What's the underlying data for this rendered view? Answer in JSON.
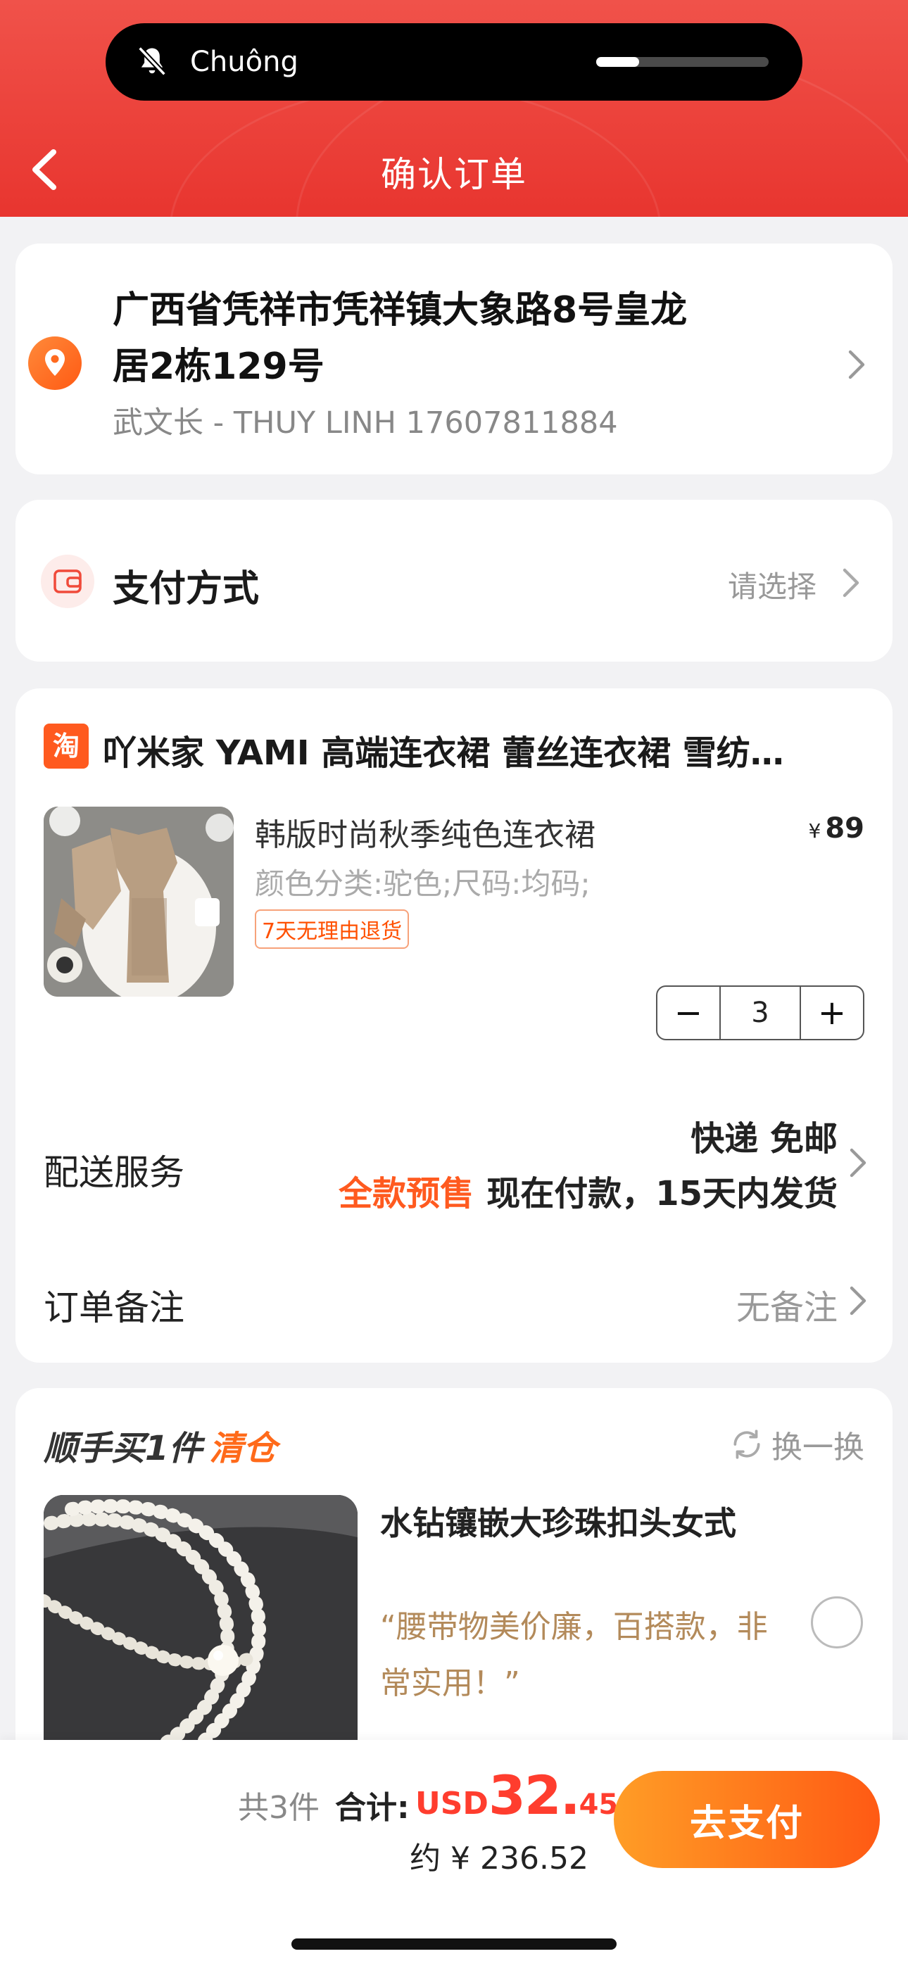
{
  "status": {
    "ringer_label": "Chuông",
    "volume_level": 0.25
  },
  "header": {
    "title": "确认订单"
  },
  "address": {
    "line1": "广西省凭祥市凭祥镇大象路8号皇龙",
    "line2": "居2栋129号",
    "contact": "武文长 - THUY LINH 17607811884"
  },
  "payment": {
    "label": "支付方式",
    "value": "请选择"
  },
  "order": {
    "shop_badge": "淘",
    "shop_name": "吖米家 YAMI 高端连衣裙 蕾丝连衣裙 雪纺…",
    "product": {
      "title": "韩版时尚秋季纯色连衣裙",
      "spec": "颜色分类:驼色;尺码:均码;",
      "tag": "7天无理由退货",
      "currency": "¥",
      "price": "89",
      "qty_minus": "−",
      "qty": "3",
      "qty_plus": "+"
    },
    "shipping": {
      "label": "配送服务",
      "line1": "快递 免邮",
      "presale": "全款预售",
      "line2": "现在付款，15天内发货"
    },
    "note": {
      "label": "订单备注",
      "value": "无备注"
    }
  },
  "recommend": {
    "title": "顺手买1件",
    "title_highlight": "清仓",
    "refresh": "换一换",
    "item_name": "水钻镶嵌大珍珠扣头女式",
    "quote": "“腰带物美价廉，百搭款，非常实用！”"
  },
  "footer": {
    "count": "共3件",
    "total_label": "合计:",
    "currency": "USD",
    "total_int": "32.",
    "total_dec": "45",
    "approx": "约 ¥ 236.52",
    "pay_button": "去支付"
  },
  "colors": {
    "header_red": "#e8352f",
    "accent_orange": "#ff5a1f",
    "price_red": "#ff3d2e",
    "quote_brown": "#b38a5a"
  }
}
